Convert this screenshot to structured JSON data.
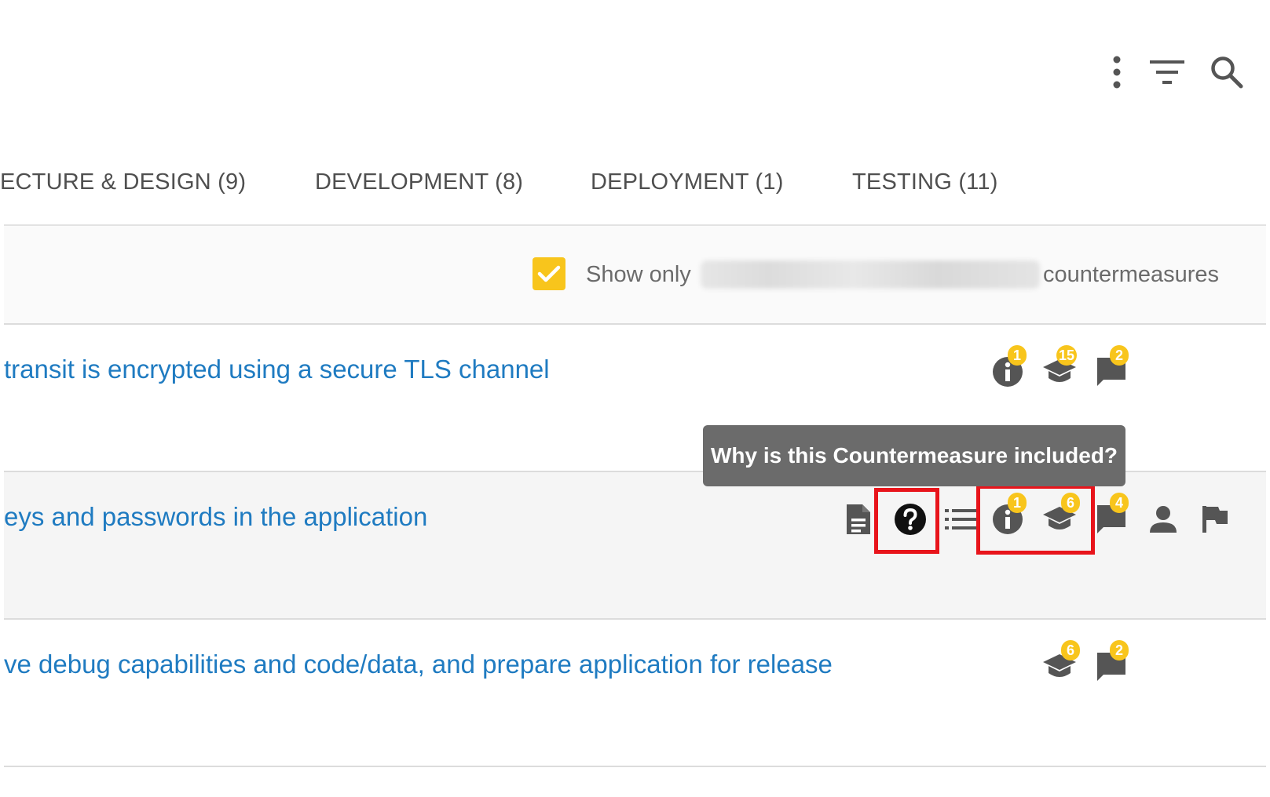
{
  "toolbar": {
    "more_icon": "more-vert-icon",
    "filter_icon": "filter-icon",
    "search_icon": "search-icon"
  },
  "tabs": [
    {
      "label": "ECTURE & DESIGN (9)"
    },
    {
      "label": "DEVELOPMENT (8)"
    },
    {
      "label": "DEPLOYMENT (1)"
    },
    {
      "label": "TESTING (11)"
    }
  ],
  "filter": {
    "checked": true,
    "prefix": "Show only",
    "suffix": "countermeasures"
  },
  "rows": [
    {
      "title": "transit is encrypted using a secure TLS channel",
      "badges": {
        "info": "1",
        "training": "15",
        "comments": "2"
      }
    },
    {
      "title": "eys and passwords in the application",
      "badges": {
        "info": "1",
        "training": "6",
        "comments": "4"
      }
    },
    {
      "title": "ve debug capabilities and code/data, and prepare application for release",
      "badges": {
        "training": "6",
        "comments": "2"
      }
    }
  ],
  "tooltip": {
    "text": "Why is this Countermeasure included?"
  },
  "colors": {
    "accent": "#f8c51c",
    "link": "#1f7bc1",
    "highlight": "#e8141b",
    "tooltip_bg": "#6b6b6b"
  }
}
